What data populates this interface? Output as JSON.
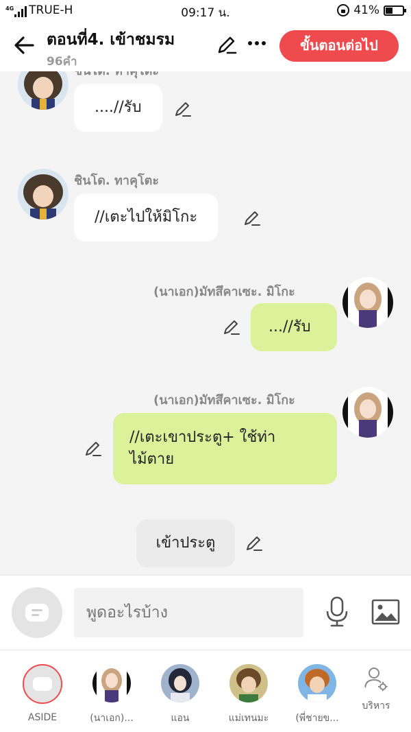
{
  "status_bar": {
    "network": "4G",
    "carrier": "TRUE-H",
    "time": "09:17 น.",
    "battery_percent": "41%",
    "battery_level": 0.41
  },
  "header": {
    "title": "ตอนที่4. เข้าชมรม",
    "word_count": "96คำ",
    "next_button": "ขั้นตอนต่อไป",
    "back_icon": "arrow-left-icon",
    "edit_icon": "pencil-icon",
    "more_icon": "more-dots-icon"
  },
  "messages": [
    {
      "side": "left",
      "sender": "ชินโด.    ทาคุโตะ",
      "text": "....//รับ",
      "bubble": "white"
    },
    {
      "side": "left",
      "sender": "ชินโด.    ทาคุโตะ",
      "text": "//เตะไปให้มิโกะ",
      "bubble": "white"
    },
    {
      "side": "right",
      "sender": "(นาเอก)มัทสึคาเซะ.     มิโกะ",
      "text": "...//รับ",
      "bubble": "green"
    },
    {
      "side": "right",
      "sender": "(นาเอก)มัทสึคาเซะ.     มิโกะ",
      "text_line1": "//เตะเขาประตู+ ใช้ท่า",
      "text_line2": "ไม้ตาย",
      "bubble": "green"
    },
    {
      "side": "center",
      "text": "เข้าประตู",
      "bubble": "gray"
    }
  ],
  "composer": {
    "placeholder": "พูดอะไรบ้าง",
    "aside_icon": "chat-bubble-icon",
    "mic_icon": "microphone-icon",
    "image_icon": "image-icon"
  },
  "characters": [
    {
      "label": "ASIDE",
      "selected": true
    },
    {
      "label": "(นาเอก)..."
    },
    {
      "label": "แอน"
    },
    {
      "label": "แม่เทนมะ"
    },
    {
      "label": "(พี่ชายข..."
    },
    {
      "label": "บริหาร"
    }
  ],
  "colors": {
    "accent": "#ef4b4f",
    "green_bubble": "#dbf29a",
    "background": "#f4f4f4"
  }
}
